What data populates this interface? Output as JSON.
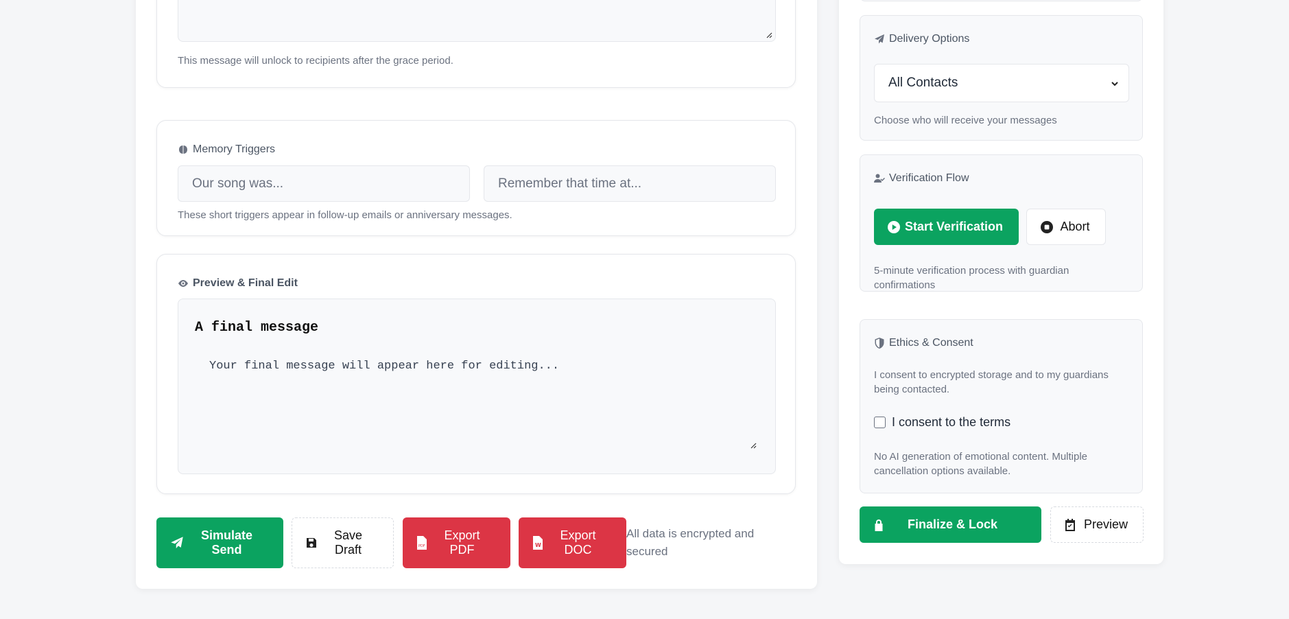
{
  "message_section": {
    "hint": "This message will unlock to recipients after the grace period."
  },
  "memory_triggers": {
    "title": "Memory Triggers",
    "input1_placeholder": "Our song was...",
    "input2_placeholder": "Remember that time at...",
    "hint": "These short triggers appear in follow-up emails or anniversary messages."
  },
  "preview": {
    "title": "Preview & Final Edit",
    "heading": "A final message",
    "body": "Your final message will appear here for editing..."
  },
  "actions": {
    "simulate_send": "Simulate Send",
    "save_draft": "Save Draft",
    "export_pdf": "Export PDF",
    "export_doc": "Export DOC",
    "security_note": "All data is encrypted and secured"
  },
  "delivery": {
    "title": "Delivery Options",
    "selected": "All Contacts",
    "hint": "Choose who will receive your messages"
  },
  "verification": {
    "title": "Verification Flow",
    "start": "Start Verification",
    "abort": "Abort",
    "hint": "5-minute verification process with guardian confirmations"
  },
  "ethics": {
    "title": "Ethics & Consent",
    "text": "I consent to encrypted storage and to my guardians being contacted.",
    "checkbox_label": "I consent to the terms",
    "checked": false,
    "note": "No AI generation of emotional content. Multiple cancellation options available."
  },
  "footer": {
    "finalize": "Finalize & Lock",
    "preview": "Preview"
  },
  "colors": {
    "accent_green": "#0ba360",
    "danger_red": "#dc3545",
    "page_bg": "#f5f6f8"
  },
  "icons": [
    "paper-plane-icon",
    "brain-icon",
    "eye-icon",
    "save-icon",
    "pdf-file-icon",
    "word-file-icon",
    "user-check-icon",
    "play-circle-icon",
    "stop-circle-icon",
    "shield-icon",
    "lock-icon",
    "calendar-check-icon",
    "chevron-down-icon"
  ]
}
